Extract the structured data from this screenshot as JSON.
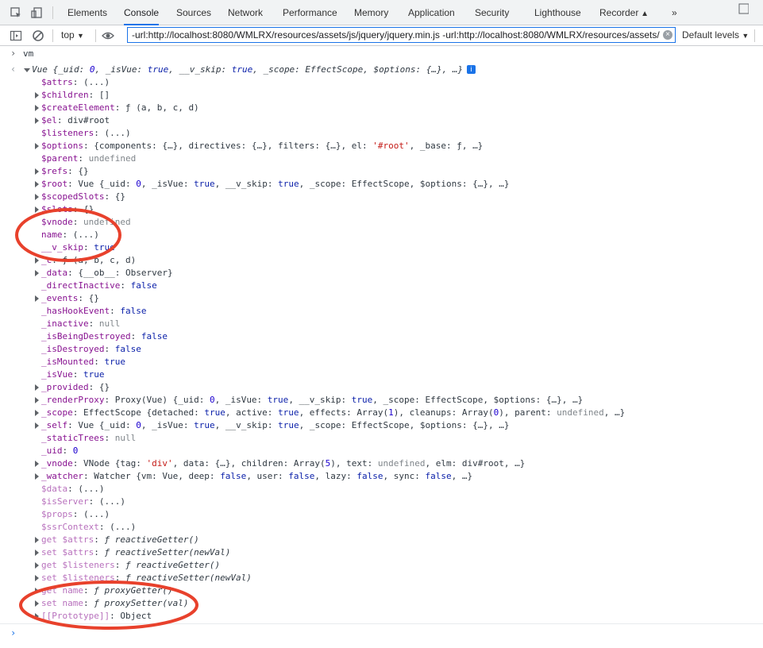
{
  "tabs": [
    "Elements",
    "Console",
    "Sources",
    "Network",
    "Performance",
    "Memory",
    "Application",
    "Security",
    "Lighthouse",
    "Recorder"
  ],
  "active_tab": "Console",
  "more_tabs": "»",
  "toolbar": {
    "context": "top",
    "filter_value": "-url:http://localhost:8080/WMLRX/resources/assets/js/jquery/jquery.min.js -url:http://localhost:8080/WMLRX/resources/assets/",
    "levels": "Default levels"
  },
  "prompt_input": "vm",
  "result_line": "Vue {_uid: 0, _isVue: true, __v_skip: true, _scope: EffectScope, $options: {…}, …}",
  "properties": [
    {
      "k": "$attrs",
      "v": "(...)"
    },
    {
      "k": "$children",
      "v": "[]",
      "exp": true
    },
    {
      "k": "$createElement",
      "v": "ƒ (a, b, c, d)",
      "exp": true
    },
    {
      "k": "$el",
      "v": "div#root",
      "exp": true
    },
    {
      "k": "$listeners",
      "v": "(...)"
    },
    {
      "k": "$options",
      "v": "{components: {…}, directives: {…}, filters: {…}, el: '#root', _base: ƒ, …}",
      "exp": true
    },
    {
      "k": "$parent",
      "v": "undefined"
    },
    {
      "k": "$refs",
      "v": "{}",
      "exp": true
    },
    {
      "k": "$root",
      "v": "Vue {_uid: 0, _isVue: true, __v_skip: true, _scope: EffectScope, $options: {…}, …}",
      "exp": true
    },
    {
      "k": "$scopedSlots",
      "v": "{}",
      "exp": true
    },
    {
      "k": "$slots",
      "v": "{}",
      "exp": true
    },
    {
      "k": "$vnode",
      "v": "undefined"
    },
    {
      "k": "name",
      "v": "(...)"
    },
    {
      "k": "__v_skip",
      "v": "true"
    },
    {
      "k": "_c",
      "v": "ƒ (a, b, c, d)",
      "exp": true
    },
    {
      "k": "_data",
      "v": "{__ob__: Observer}",
      "exp": true
    },
    {
      "k": "_directInactive",
      "v": "false"
    },
    {
      "k": "_events",
      "v": "{}",
      "exp": true
    },
    {
      "k": "_hasHookEvent",
      "v": "false"
    },
    {
      "k": "_inactive",
      "v": "null"
    },
    {
      "k": "_isBeingDestroyed",
      "v": "false"
    },
    {
      "k": "_isDestroyed",
      "v": "false"
    },
    {
      "k": "_isMounted",
      "v": "true"
    },
    {
      "k": "_isVue",
      "v": "true"
    },
    {
      "k": "_provided",
      "v": "{}",
      "exp": true
    },
    {
      "k": "_renderProxy",
      "v": "Proxy(Vue) {_uid: 0, _isVue: true, __v_skip: true, _scope: EffectScope, $options: {…}, …}",
      "exp": true
    },
    {
      "k": "_scope",
      "v": "EffectScope {detached: true, active: true, effects: Array(1), cleanups: Array(0), parent: undefined, …}",
      "exp": true
    },
    {
      "k": "_self",
      "v": "Vue {_uid: 0, _isVue: true, __v_skip: true, _scope: EffectScope, $options: {…}, …}",
      "exp": true
    },
    {
      "k": "_staticTrees",
      "v": "null"
    },
    {
      "k": "_uid",
      "v": "0"
    },
    {
      "k": "_vnode",
      "v": "VNode {tag: 'div', data: {…}, children: Array(5), text: undefined, elm: div#root, …}",
      "exp": true
    },
    {
      "k": "_watcher",
      "v": "Watcher {vm: Vue, deep: false, user: false, lazy: false, sync: false, …}",
      "exp": true
    },
    {
      "k": "$data",
      "v": "(...)",
      "dim": true
    },
    {
      "k": "$isServer",
      "v": "(...)",
      "dim": true
    },
    {
      "k": "$props",
      "v": "(...)",
      "dim": true
    },
    {
      "k": "$ssrContext",
      "v": "(...)",
      "dim": true
    },
    {
      "k": "get $attrs",
      "v": "ƒ reactiveGetter()",
      "dim": true,
      "exp": true,
      "fn": true
    },
    {
      "k": "set $attrs",
      "v": "ƒ reactiveSetter(newVal)",
      "dim": true,
      "exp": true,
      "fn": true
    },
    {
      "k": "get $listeners",
      "v": "ƒ reactiveGetter()",
      "dim": true,
      "exp": true,
      "fn": true
    },
    {
      "k": "set $listeners",
      "v": "ƒ reactiveSetter(newVal)",
      "dim": true,
      "exp": true,
      "fn": true
    },
    {
      "k": "get name",
      "v": "ƒ proxyGetter()",
      "dim": true,
      "exp": true,
      "fn": true
    },
    {
      "k": "set name",
      "v": "ƒ proxySetter(val)",
      "dim": true,
      "exp": true,
      "fn": true
    },
    {
      "k": "[[Prototype]]",
      "v": "Object",
      "dim": true,
      "exp": true
    }
  ],
  "colors": {
    "accent": "#1a73e8",
    "annotation": "#e8412c",
    "key": "#881391",
    "key_dim": "#b871bd",
    "num": "#1c00cf",
    "kw": "#0d22aa",
    "str": "#c41a16"
  },
  "icons": [
    "inspect-icon",
    "device-toggle-icon",
    "sidebar-icon",
    "clear-icon",
    "eye-icon",
    "settings-icon",
    "info-icon"
  ]
}
